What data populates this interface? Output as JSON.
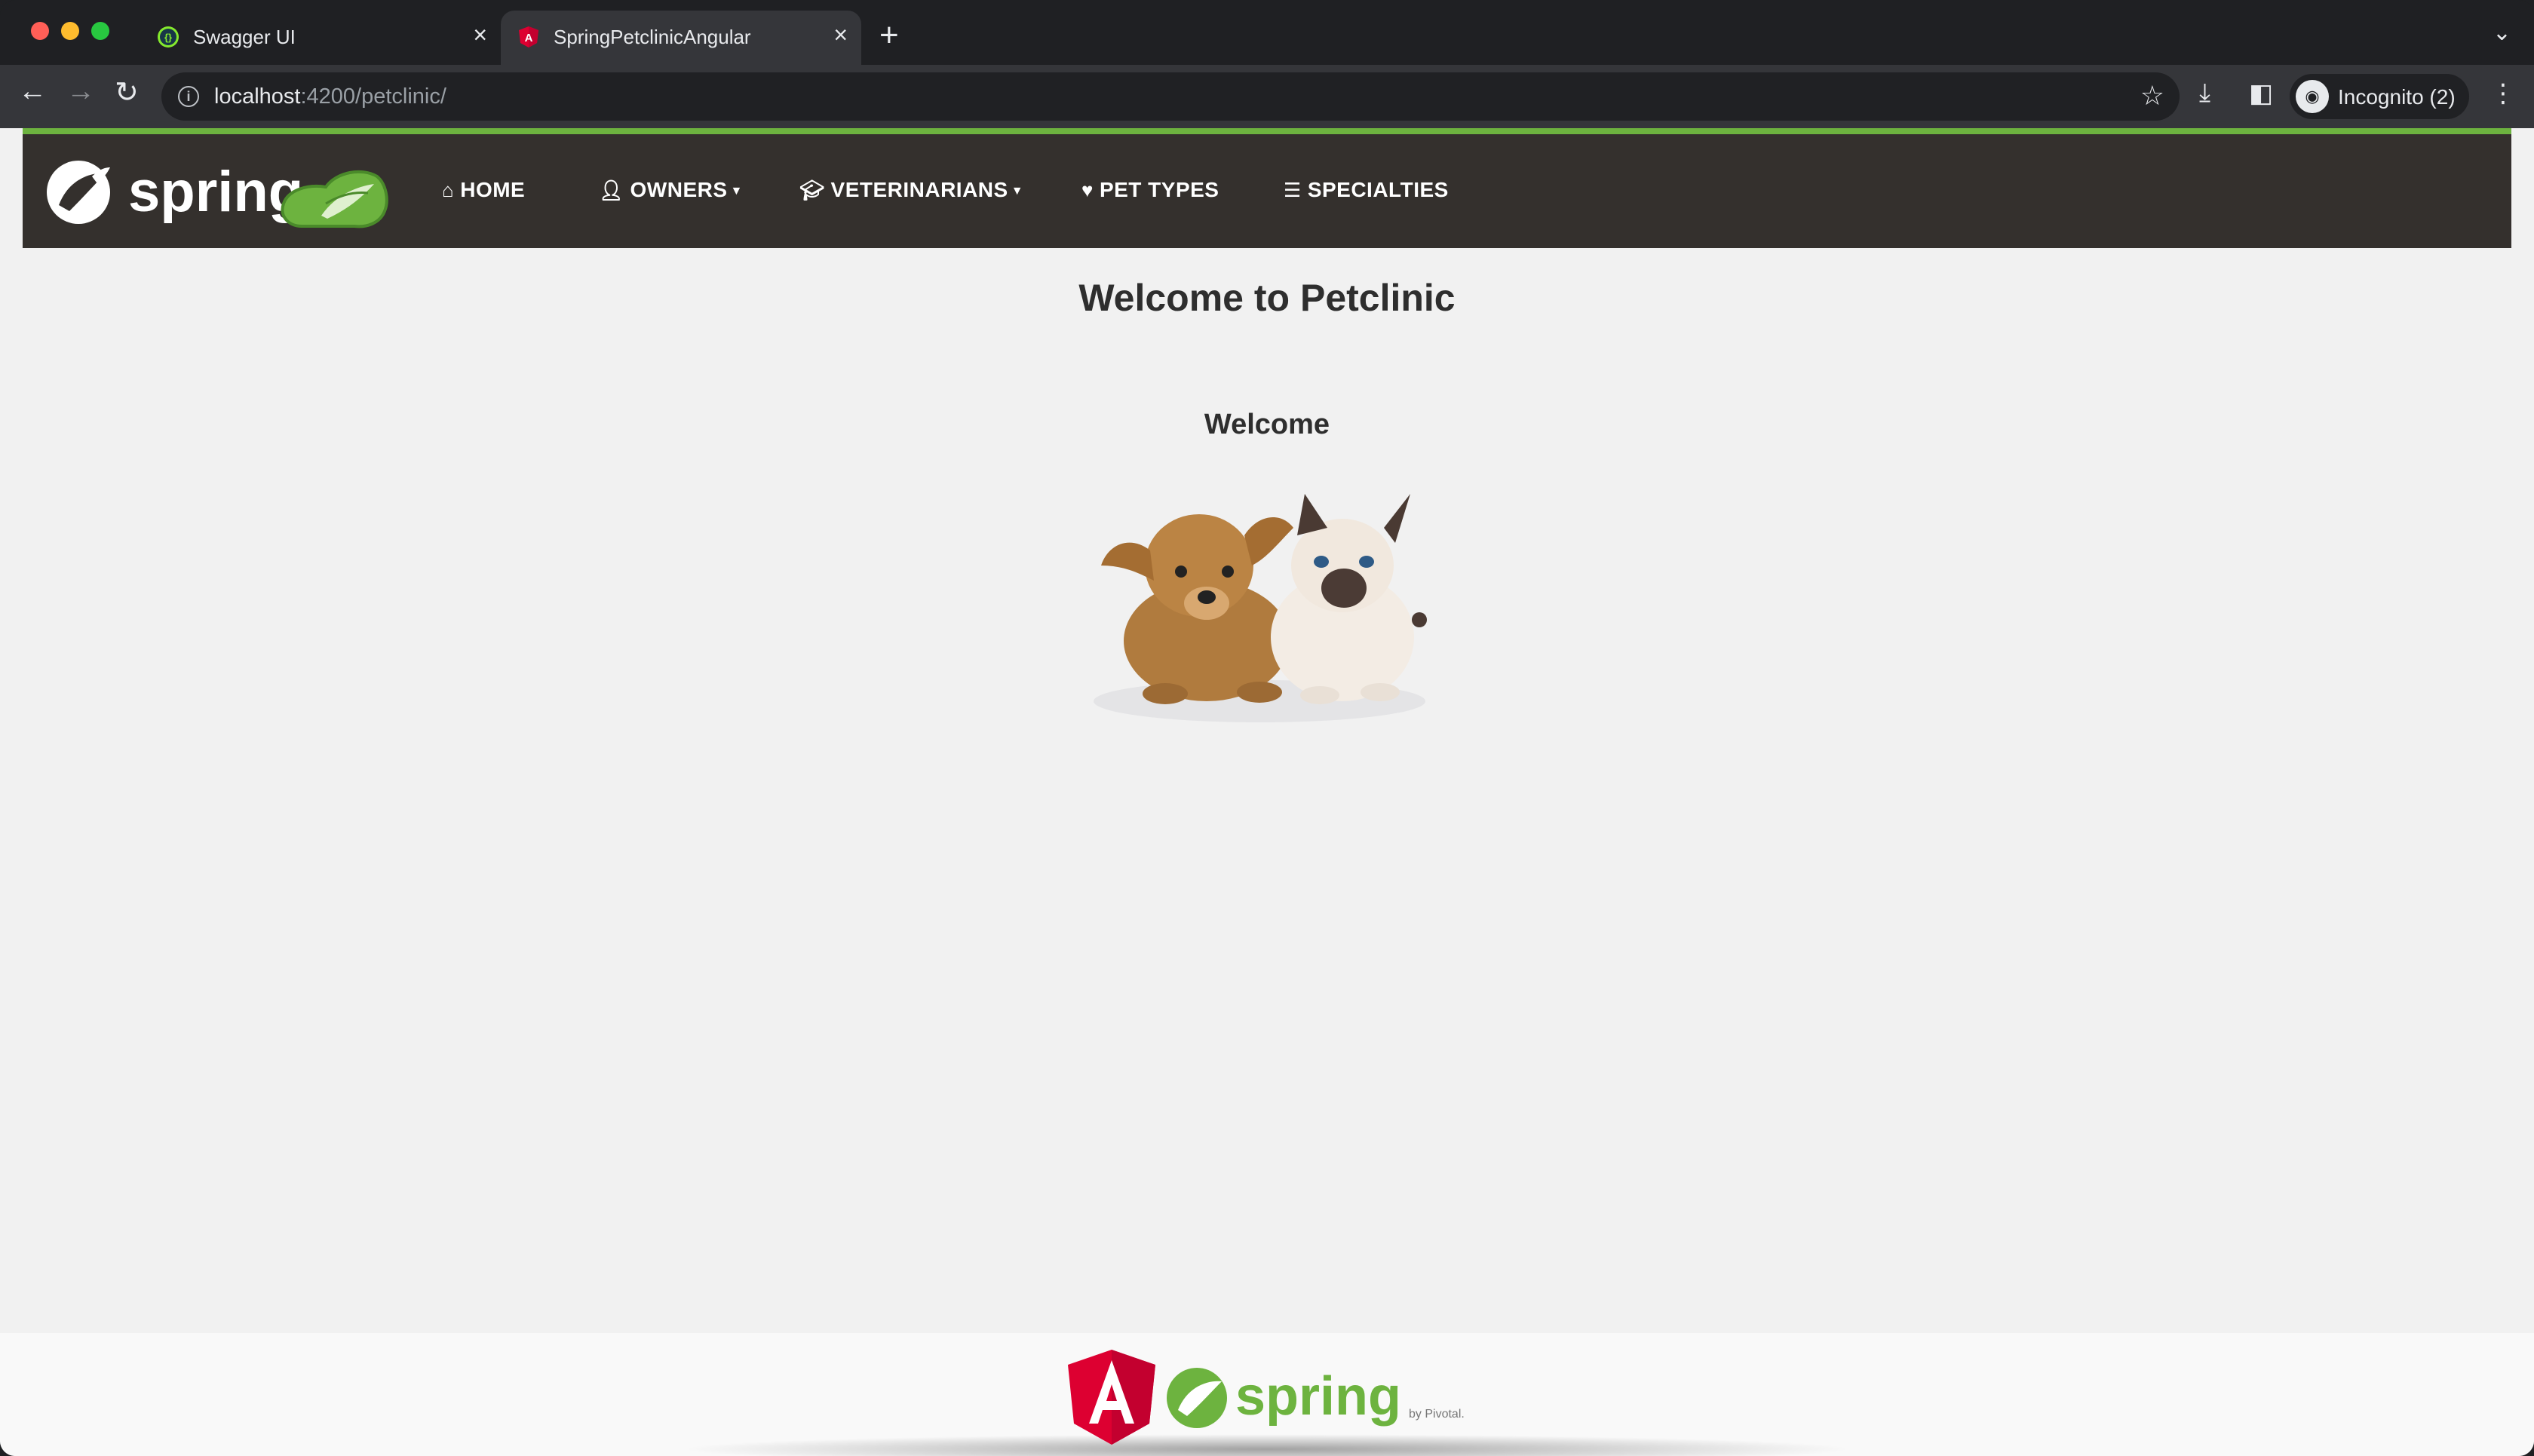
{
  "browser": {
    "tabs": [
      {
        "title": "Swagger UI",
        "icon": "swagger-icon",
        "active": false
      },
      {
        "title": "SpringPetclinicAngular",
        "icon": "angular-icon",
        "active": true
      }
    ],
    "close_glyph": "×",
    "new_tab_glyph": "+",
    "address": {
      "host": "localhost",
      "path": ":4200/petclinic/"
    },
    "profile_label": "Incognito (2)"
  },
  "app": {
    "brand": "spring",
    "nav": [
      {
        "label": "HOME",
        "icon": "home-icon",
        "dropdown": false
      },
      {
        "label": "OWNERS",
        "icon": "user-icon",
        "dropdown": true
      },
      {
        "label": "VETERINARIANS",
        "icon": "graduation-cap-icon",
        "dropdown": true
      },
      {
        "label": "PET TYPES",
        "icon": "heart-icon",
        "dropdown": false
      },
      {
        "label": "SPECIALTIES",
        "icon": "list-icon",
        "dropdown": false
      }
    ],
    "page_title": "Welcome to Petclinic",
    "welcome_heading": "Welcome",
    "footer": {
      "spring_text": "spring",
      "pivotal_text": "by Pivotal."
    }
  },
  "colors": {
    "spring_green": "#6db33f",
    "nav_background": "#34302d",
    "page_background": "#f1f1f1",
    "angular_red": "#dd0031"
  }
}
